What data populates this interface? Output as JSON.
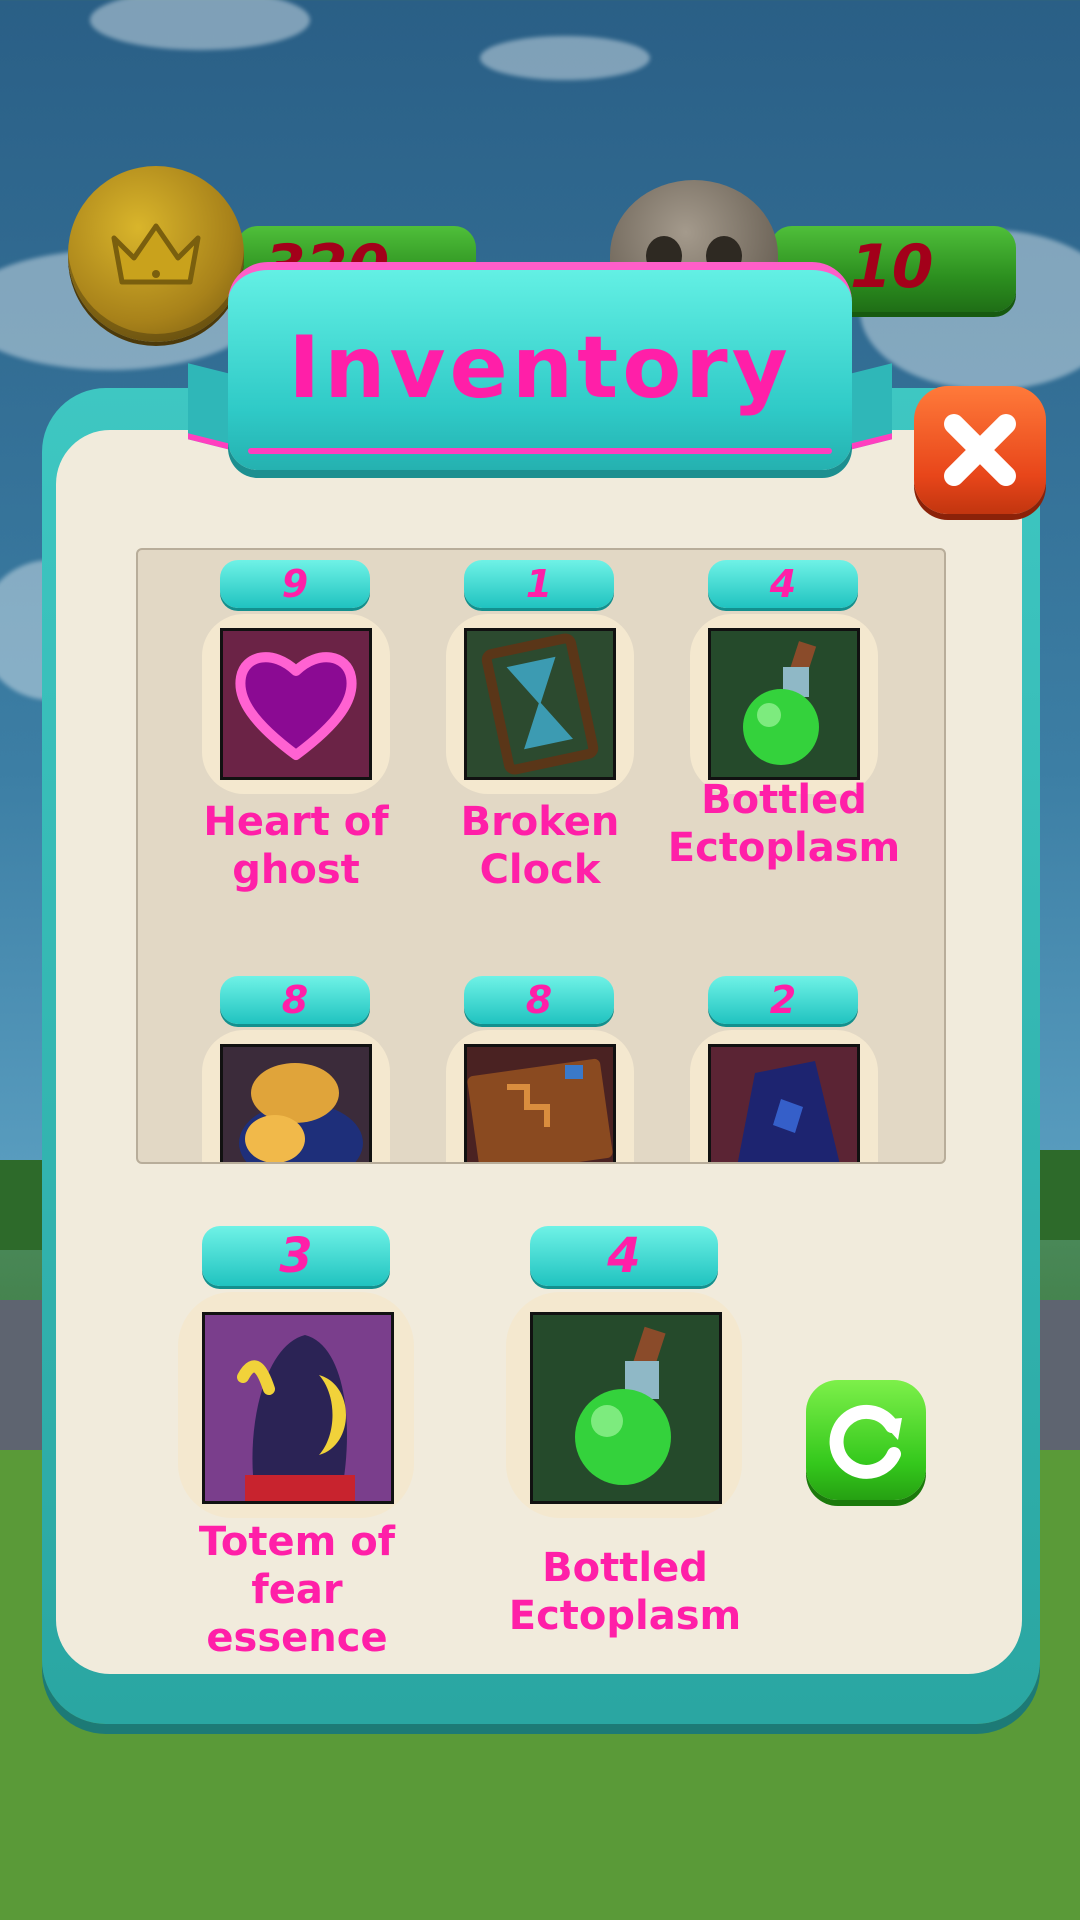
{
  "currency": {
    "coins_value": "320",
    "skulls_value": "10"
  },
  "dialog": {
    "title": "Inventory"
  },
  "grid_items": [
    {
      "count": "9",
      "name": "Heart of ghost",
      "icon": "heart-icon"
    },
    {
      "count": "1",
      "name": "Broken Clock",
      "icon": "hourglass-icon"
    },
    {
      "count": "4",
      "name": "Bottled Ectoplasm",
      "icon": "potion-icon"
    },
    {
      "count": "8",
      "name": "",
      "icon": "bread-icon"
    },
    {
      "count": "8",
      "name": "",
      "icon": "book-icon"
    },
    {
      "count": "2",
      "name": "",
      "icon": "crystal-icon"
    }
  ],
  "selected_items": [
    {
      "count": "3",
      "name": "Totem of fear essence",
      "icon": "totem-icon"
    },
    {
      "count": "4",
      "name": "Bottled Ectoplasm",
      "icon": "potion-icon"
    }
  ],
  "colors": {
    "accent_pink": "#ff1fa8",
    "panel_teal": "#2fcac7",
    "close_red": "#e8461a",
    "refresh_green": "#34c81c"
  }
}
